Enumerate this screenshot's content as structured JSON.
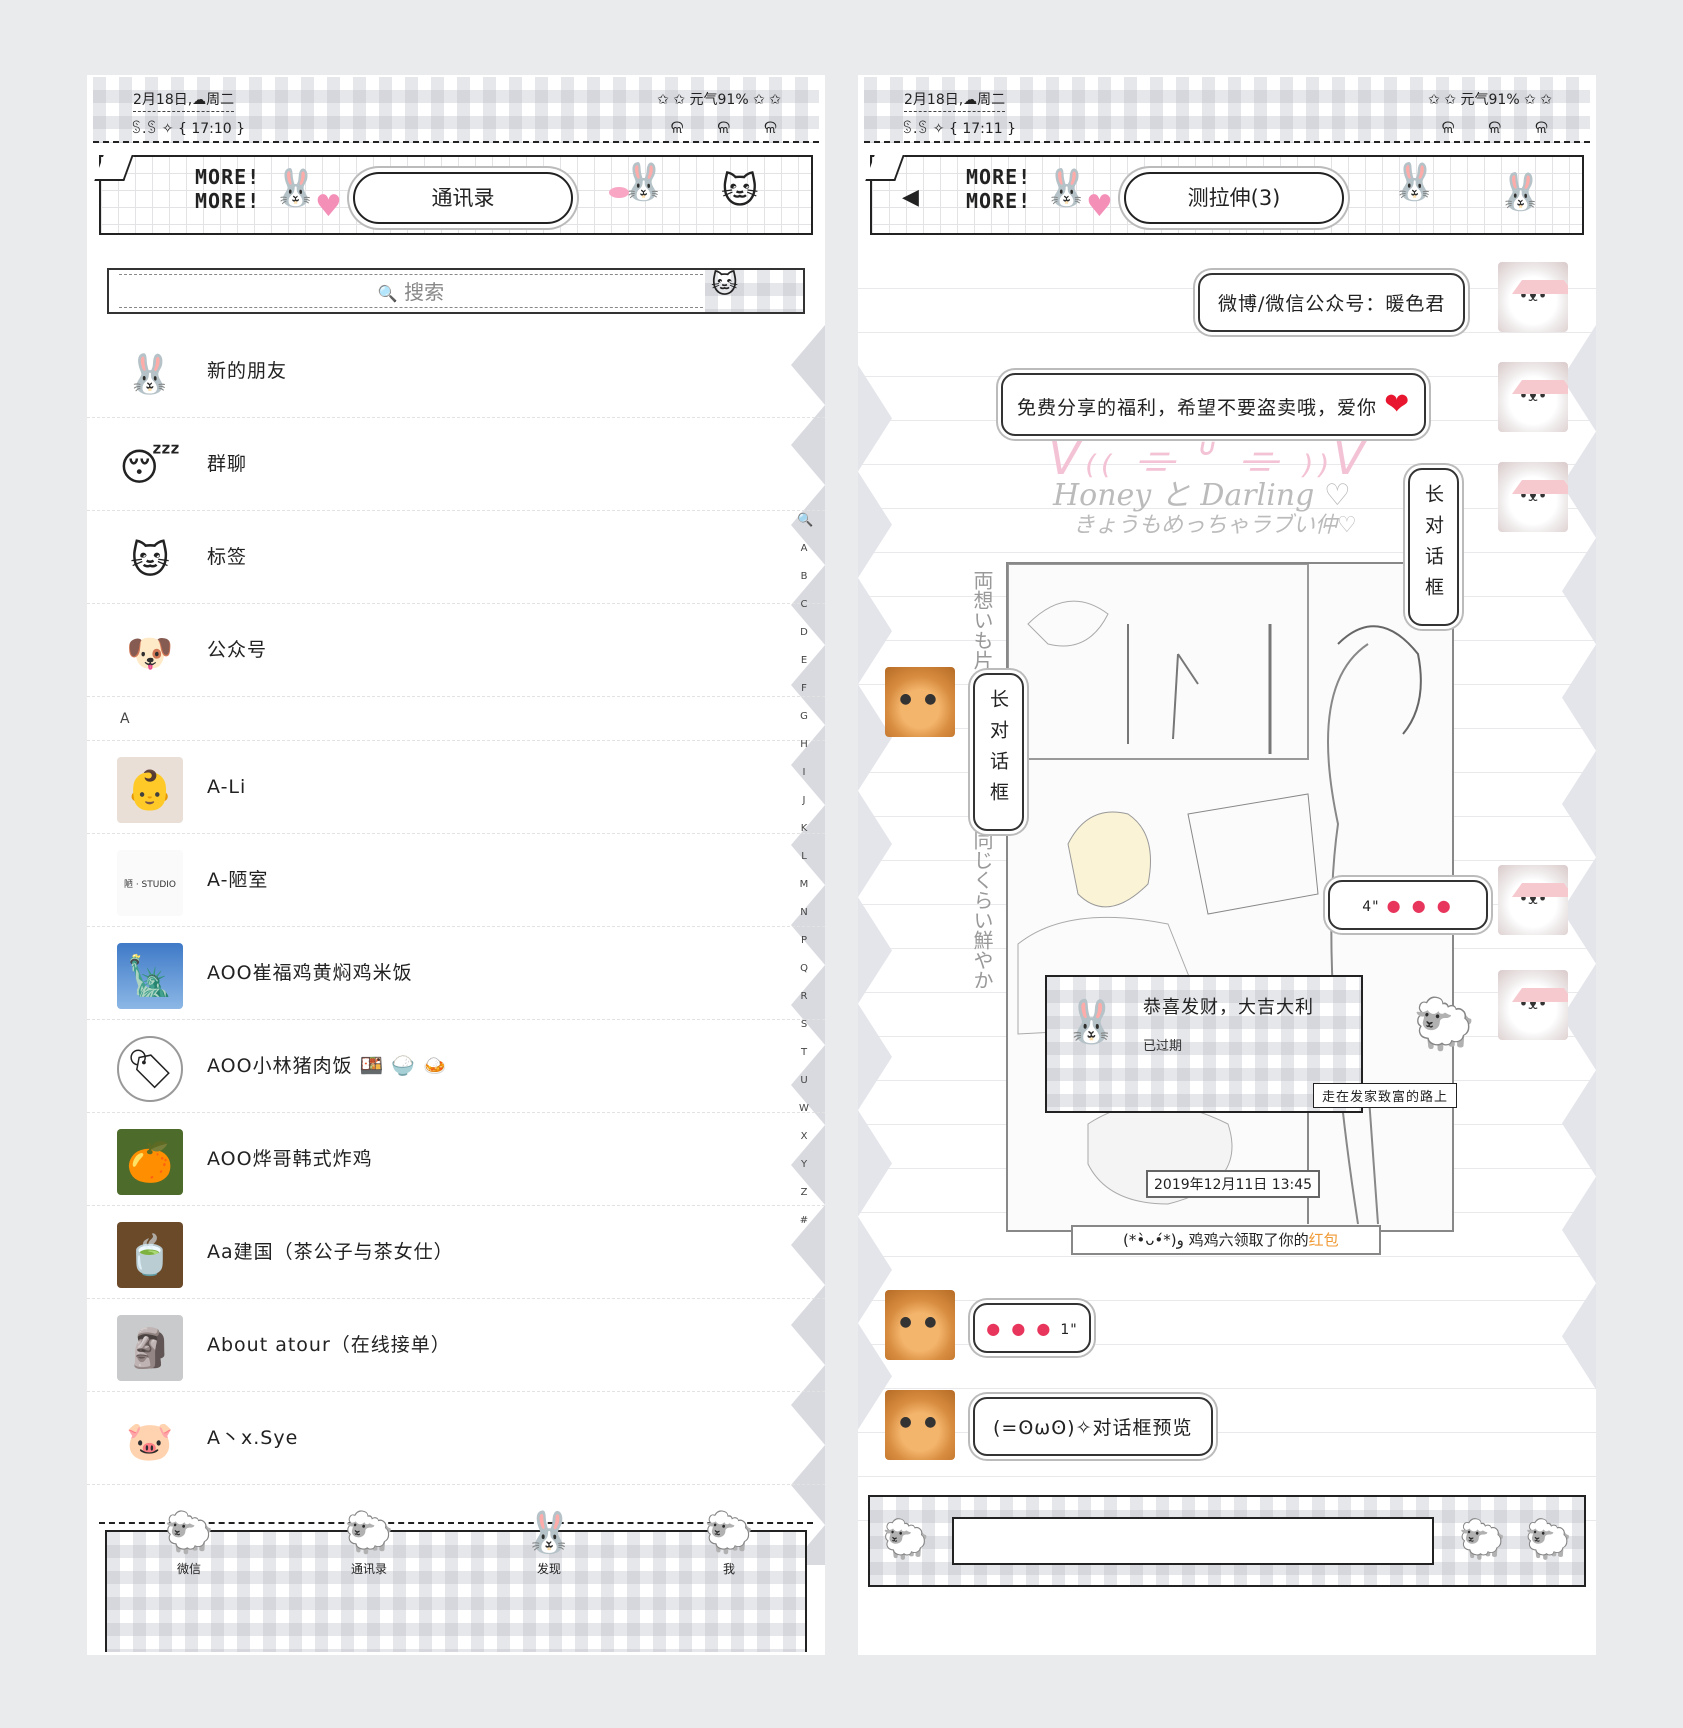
{
  "left": {
    "status": {
      "date": "2月18日,☁周二",
      "time": "ꌗ.ꌗ ✧ { 17:10 }",
      "battery": "✩ ✩ 元气91% ✩ ✩",
      "deco": "ଳ ଳ ଳ"
    },
    "header": {
      "more": "MORE!\nMORE!",
      "title": "通讯录"
    },
    "search": {
      "placeholder_icon": "🔍",
      "placeholder": "搜索"
    },
    "fixed_items": [
      {
        "name": "新的朋友",
        "icon": "🐰"
      },
      {
        "name": "群聊",
        "icon": "😴"
      },
      {
        "name": "标签",
        "icon": "🐱"
      },
      {
        "name": "公众号",
        "icon": "🐶"
      }
    ],
    "section": "A",
    "contacts": [
      {
        "name": "A-Li",
        "icon": "👶"
      },
      {
        "name": "A-陋室",
        "icon": "陋 · STUDIO"
      },
      {
        "name": "AOO崔福鸡黄焖鸡米饭",
        "icon": "🗽"
      },
      {
        "name": "AOO小林猪肉饭 🍱 🍚 🍛",
        "icon": "🏷"
      },
      {
        "name": "AOO烨哥韩式炸鸡",
        "icon": "🍊"
      },
      {
        "name": "Aa建国（茶公子与茶女仕）",
        "icon": "🍵"
      },
      {
        "name": "About atour（在线接单）",
        "icon": "🗿"
      },
      {
        "name": "A丶x.Sye",
        "icon": "🐷"
      }
    ],
    "index": [
      "🔍",
      "A",
      "B",
      "C",
      "D",
      "E",
      "F",
      "G",
      "H",
      "I",
      "J",
      "K",
      "L",
      "M",
      "N",
      "P",
      "Q",
      "R",
      "S",
      "T",
      "U",
      "W",
      "X",
      "Y",
      "Z",
      "#"
    ],
    "tabs": [
      {
        "label": "微信",
        "icon": "🐑"
      },
      {
        "label": "通讯录",
        "icon": "🐑"
      },
      {
        "label": "发现",
        "icon": "🐰"
      },
      {
        "label": "我",
        "icon": "🐑"
      }
    ]
  },
  "right": {
    "status": {
      "date": "2月18日,☁周二",
      "time": "ꌗ.ꌗ ✧ { 17:11 }",
      "battery": "✩ ✩ 元气91% ✩ ✩",
      "deco": "ଳ ଳ ଳ"
    },
    "header": {
      "more": "MORE!\nMORE!",
      "title": "测拉伸(3)",
      "back": "◀"
    },
    "bg_text": {
      "title": "V₍₍ ⌯ ᐡ ⌯ ₎₎V",
      "honey": "Honey と Darling ♡",
      "honey2": "きょうもめっちゃラブい仲♡",
      "vertical": "両想いも片想いもう気もちは同じくらい鮮やか"
    },
    "messages": [
      {
        "text": "微博/微信公众号：暖色君"
      },
      {
        "text": "免费分享的福利，希望不要盗卖哦，爱你",
        "heart": "❤"
      },
      {
        "text": "长对话框"
      },
      {
        "text": "长对话框"
      },
      {
        "prefix": "4\"",
        "hearts": "● ● ●"
      },
      {
        "hearts": "● ● ●",
        "suffix": "1\""
      },
      {
        "text": "(=ʘωʘ)✧对话框预览"
      }
    ],
    "red_packet": {
      "title": "恭喜发财，大吉大利",
      "status": "已过期",
      "ribbon": "走在发家致富的路上",
      "icon": "🐰"
    },
    "timestamp": "2019年12月11日 13:45",
    "system_msg": {
      "prefix": "(*•̀ᴗ•́*)و 鸡鸡六领取了你的",
      "link": "红包"
    },
    "input": {
      "left_icon": "🐑",
      "right_icon1": "🐑",
      "right_icon2": "🐑"
    }
  }
}
